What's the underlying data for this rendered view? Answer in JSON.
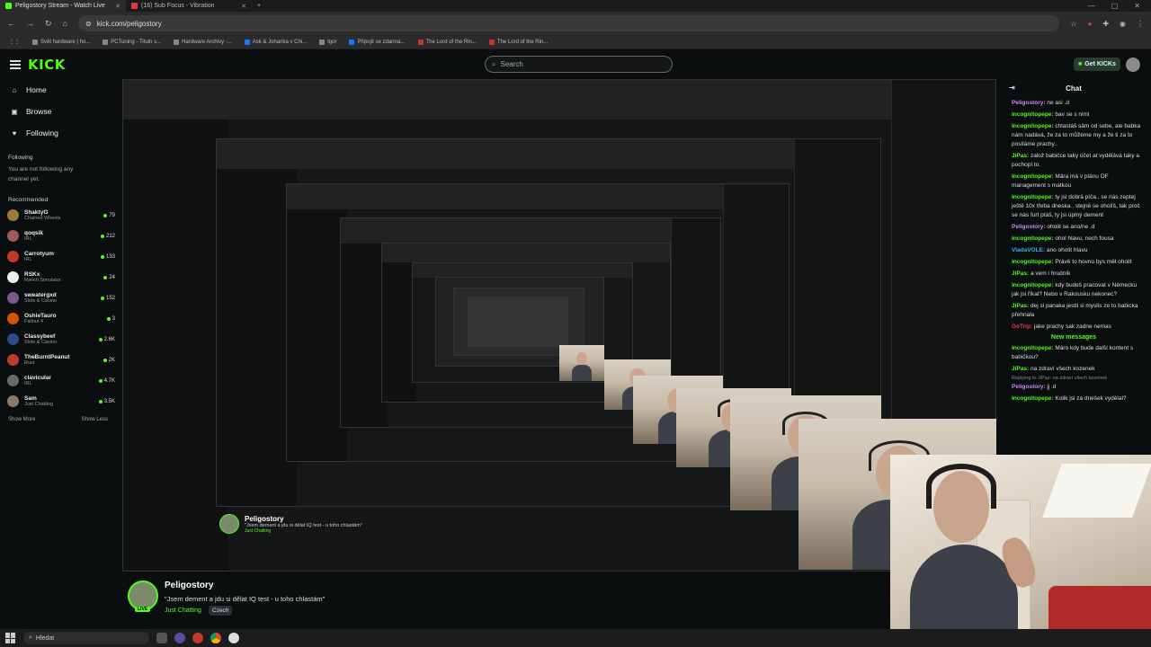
{
  "browser": {
    "tabs": [
      {
        "label": "Peligostory Stream - Watch Live",
        "icon": "kick-favicon",
        "color": "#53fc18",
        "active": true
      },
      {
        "label": "(16) Sub Focus - Vibration",
        "icon": "youtube-favicon",
        "color": "#e53935",
        "active": false
      }
    ],
    "url": "kick.com/peligostory",
    "bookmarks": [
      "Svět hardware | ho...",
      "PCTuning - Tituln s...",
      "Hardware Archivy -...",
      "Ask & Johanka v Chi...",
      "Igor",
      "Připojit se zdarma...",
      "The Lord of the Rin...",
      "The Lord of the Rin..."
    ]
  },
  "header": {
    "logo": "KICK",
    "search_placeholder": "Search",
    "get_kicks": "Get KICKs"
  },
  "sidebar": {
    "nav": [
      {
        "label": "Home",
        "icon": "home-icon",
        "glyph": "⌂"
      },
      {
        "label": "Browse",
        "icon": "browse-icon",
        "glyph": "▣"
      },
      {
        "label": "Following",
        "icon": "heart-icon",
        "glyph": "♥"
      }
    ],
    "following_title": "Following",
    "following_empty": "You are not following any channel yet.",
    "recommended_title": "Recommended",
    "recommended": [
      {
        "name": "ShaktyG",
        "category": "Chained Wheels",
        "viewers": "79",
        "color": "#9c7a3c"
      },
      {
        "name": "qoqsik",
        "category": "IRL",
        "viewers": "212",
        "color": "#a05a5a"
      },
      {
        "name": "Carrotyum",
        "category": "IRL",
        "viewers": "133",
        "color": "#c0392b"
      },
      {
        "name": "RSKx",
        "category": "Ranch Simulator",
        "viewers": "24",
        "color": "#eeeeee"
      },
      {
        "name": "sweatergxd",
        "category": "Slots & Casino",
        "viewers": "152",
        "color": "#7a5a8a"
      },
      {
        "name": "OshieTauro",
        "category": "Fallout 4",
        "viewers": "3",
        "color": "#d35400"
      },
      {
        "name": "Classybeef",
        "category": "Slots & Casino",
        "viewers": "2.6K",
        "color": "#2e4a8a"
      },
      {
        "name": "TheBurntPeanut",
        "category": "Rust",
        "viewers": "2K",
        "color": "#c0392b"
      },
      {
        "name": "clavicular",
        "category": "IRL",
        "viewers": "4.7K",
        "color": "#6a6a6a"
      },
      {
        "name": "Sam",
        "category": "Just Chatting",
        "viewers": "3.5K",
        "color": "#8a7a6a"
      }
    ],
    "show_more": "Show More",
    "show_less": "Show Less"
  },
  "stream": {
    "streamer": "Peligostory",
    "title": "\"Jsem dement a jdu si dělat IQ test - u toho chlastám\"",
    "category": "Just Chatting",
    "language": "Czech",
    "live_badge": "LIVE"
  },
  "chat": {
    "title": "Chat",
    "messages": [
      {
        "user": "Peligostory:",
        "text": "ne asi .d",
        "color": "#c98af0"
      },
      {
        "user": "incognitopepe:",
        "text": "bav se s nimi",
        "color": "#53fc18"
      },
      {
        "user": "incognitopepe:",
        "text": "chlastáš sám od sebe, ale babka nám nadává, že za to můžeme my a že ti za to posíláme prachy..",
        "color": "#53fc18"
      },
      {
        "user": "JiPas:",
        "text": "založ babičce taky účet at vydělává taky a pochopí to.",
        "color": "#53fc18"
      },
      {
        "user": "incognitopepe:",
        "text": "Mára má v plánu OF management s matkou",
        "color": "#53fc18"
      },
      {
        "user": "incognitopepe:",
        "text": "ty jsi dobrá píča.. se nás zeptej ještě 10x třeba dneska.. stejně se oholíš, tak proč se nás furt ptáš, ty jsi úplný dement",
        "color": "#53fc18"
      },
      {
        "user": "Peligostory:",
        "text": "oholit se ano/ne .d",
        "color": "#c98af0"
      },
      {
        "user": "incognitopepe:",
        "text": "ohol hlavu, nech fousa",
        "color": "#53fc18"
      },
      {
        "user": "ViadaVOLE:",
        "text": "ano oholit hlavu",
        "color": "#3ab0e0"
      },
      {
        "user": "incognitopepe:",
        "text": "Právě to hovno bys měl oholit",
        "color": "#53fc18"
      },
      {
        "user": "JiPas:",
        "text": "a vem i hrudník",
        "color": "#53fc18"
      },
      {
        "user": "incognitopepe:",
        "text": "kdy budeš pracovat v Německu jak jsi říkal? Nebo v Rakousku nekonec?",
        "color": "#53fc18"
      },
      {
        "user": "JiPas:",
        "text": "dej si panaka jestli si myslis ze to babicka přehnala",
        "color": "#53fc18"
      },
      {
        "user": "GoTrip:",
        "text": "jake prachy sak zadne nemas",
        "color": "#e04040"
      }
    ],
    "new_messages": "New messages",
    "messages_after": [
      {
        "user": "incognitopepe:",
        "text": "Máro kdy bude další kontent s babičkou?",
        "color": "#53fc18"
      },
      {
        "user": "JiPas:",
        "text": "na zdraví všech kozenek",
        "color": "#53fc18"
      }
    ],
    "reply_note": "Replying to JiPas: na zdraví všech kozenek",
    "messages_last": [
      {
        "user": "Peligostory:",
        "text": "jj .d",
        "color": "#c98af0"
      },
      {
        "user": "incognitopepe:",
        "text": "Kolik jsi za dnešek vydělal?",
        "color": "#53fc18"
      }
    ]
  },
  "taskbar": {
    "search_placeholder": "Hledat"
  },
  "colors": {
    "accent": "#53fc18",
    "background": "#0b0e0f"
  }
}
